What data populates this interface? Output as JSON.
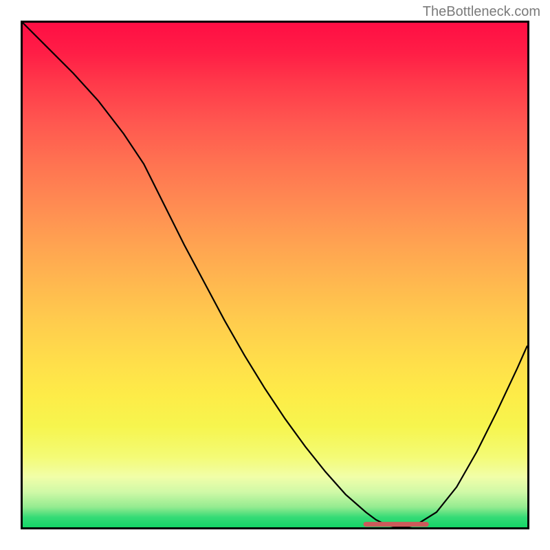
{
  "watermark": "TheBottleneck.com",
  "chart_data": {
    "type": "line",
    "title": "",
    "xlabel": "",
    "ylabel": "",
    "xlim": [
      0,
      100
    ],
    "ylim": [
      0,
      100
    ],
    "series": [
      {
        "name": "curve",
        "x": [
          0,
          5,
          10,
          15,
          20,
          24,
          28,
          32,
          36,
          40,
          44,
          48,
          52,
          56,
          60,
          64,
          68,
          70,
          72,
          74,
          76,
          78,
          82,
          86,
          90,
          94,
          98,
          100
        ],
        "y": [
          100,
          95,
          90,
          84.5,
          78,
          72,
          64,
          56,
          48.5,
          41,
          34,
          27.5,
          21.5,
          16,
          11,
          6.5,
          3,
          1.5,
          0.5,
          0,
          0,
          0.5,
          3,
          8,
          15,
          23,
          31.5,
          36
        ]
      }
    ],
    "marker": {
      "name": "highlight-segment",
      "x_start": 68,
      "x_end": 80,
      "y": 0.6
    },
    "gradient_stops": [
      {
        "pos": 0,
        "color": "#ff0e44"
      },
      {
        "pos": 20,
        "color": "#ff5850"
      },
      {
        "pos": 44,
        "color": "#ffa351"
      },
      {
        "pos": 68,
        "color": "#ffe04a"
      },
      {
        "pos": 86,
        "color": "#f4fb75"
      },
      {
        "pos": 96,
        "color": "#94eb90"
      },
      {
        "pos": 100,
        "color": "#14d567"
      }
    ]
  }
}
